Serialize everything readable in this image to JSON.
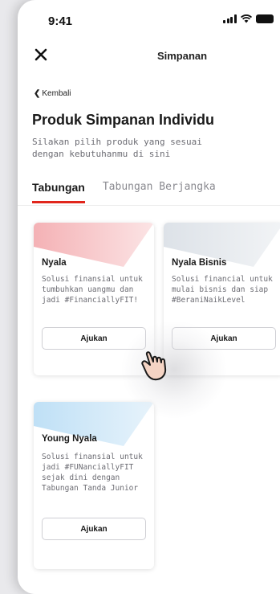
{
  "status_bar": {
    "time": "9:41"
  },
  "header": {
    "title": "Simpanan"
  },
  "back": {
    "label": "Kembali"
  },
  "page": {
    "heading": "Produk Simpanan Individu",
    "subtitle": "Silakan pilih produk yang sesuai dengan kebutuhanmu di sini"
  },
  "tabs": [
    {
      "label": "Tabungan",
      "active": true
    },
    {
      "label": "Tabungan Berjangka",
      "active": false
    }
  ],
  "cards": [
    {
      "title": "Nyala",
      "desc": "Solusi finansial untuk tumbuhkan uangmu dan jadi #FinanciallyFIT!",
      "button": "Ajukan",
      "accent": "#f6c7c9"
    },
    {
      "title": "Nyala Bisnis",
      "desc": "Solusi financial untuk mulai bisnis dan siap #BeraniNaikLevel",
      "button": "Ajukan",
      "accent": "#e3e7ec"
    },
    {
      "title": "Young Nyala",
      "desc": "Solusi finansial untuk jadi #FUNanciallyFIT sejak dini dengan\nTabungan Tanda Junior",
      "button": "Ajukan",
      "accent": "#cde6f7"
    }
  ],
  "colors": {
    "brand_red": "#e1261c",
    "text_primary": "#1a1a1a",
    "text_secondary": "#6c6c73"
  },
  "icons": [
    "close-icon",
    "chevron-left-icon",
    "signal-icon",
    "wifi-icon",
    "battery-icon",
    "tap-hand-icon"
  ]
}
